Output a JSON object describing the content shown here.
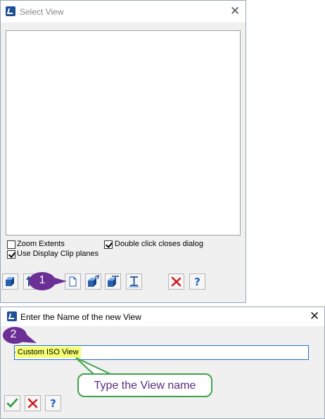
{
  "select_view_dialog": {
    "title": "Select View",
    "checkboxes": [
      {
        "label": "Zoom Extents",
        "checked": false
      },
      {
        "label": "Use Display Clip planes",
        "checked": true
      },
      {
        "label": "Double click closes dialog",
        "checked": true
      }
    ],
    "toolbar_icons": [
      "view-cube-icon",
      "sort-icon",
      "new-view-icon",
      "iso-view-icon",
      "section-view-icon",
      "plan-view-icon",
      "clip-planes-icon",
      "delete-icon",
      "help-icon"
    ]
  },
  "new_view_dialog": {
    "title": "Enter the Name of the new View",
    "name_value": "Custom ISO View",
    "toolbar_icons": [
      "ok-icon",
      "cancel-icon",
      "help-icon"
    ]
  },
  "annotations": {
    "step1": "1",
    "step2": "2",
    "callout": "Type the View name"
  },
  "colors": {
    "badge": "#6b2f96",
    "callout_border": "#3fa34d",
    "callout_text": "#5b2c82",
    "highlight": "#f5ff73",
    "input_border": "#1e6fc8"
  }
}
